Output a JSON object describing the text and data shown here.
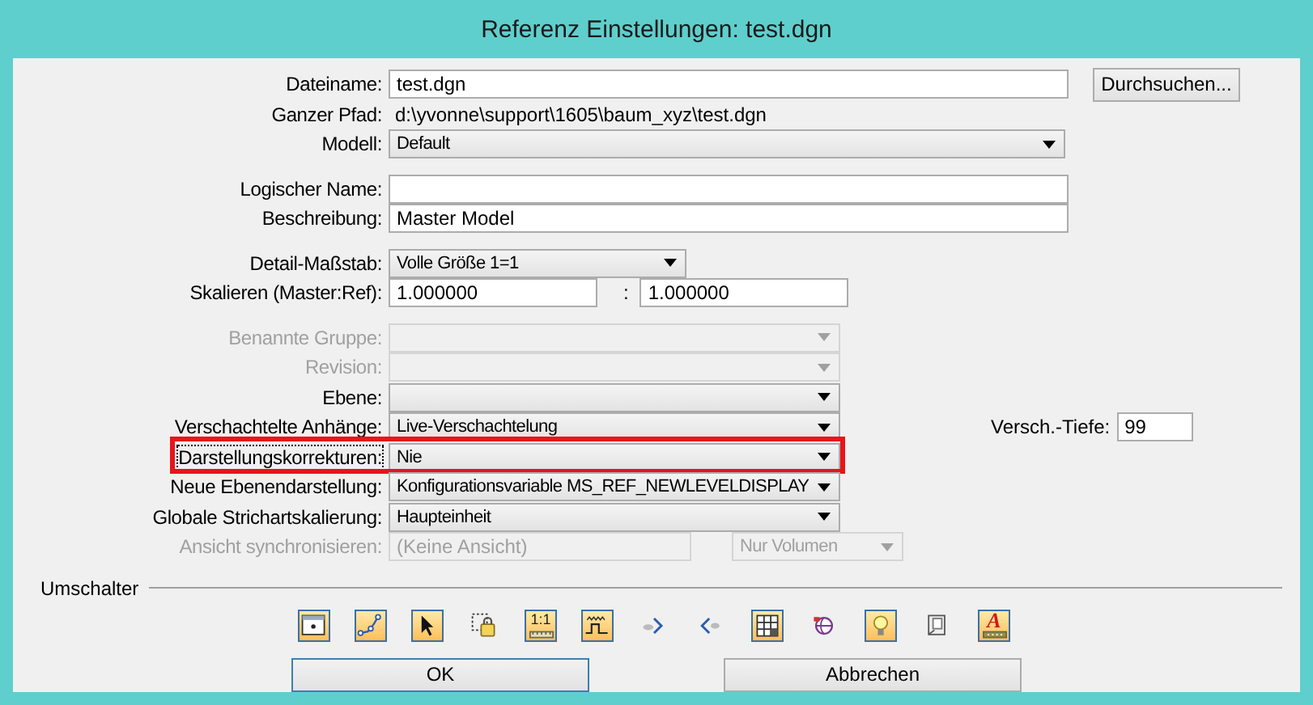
{
  "window": {
    "title": "Referenz Einstellungen: test.dgn"
  },
  "sections": [
    {
      "rows": [
        {
          "kind": "field",
          "label": "Dateiname:",
          "value": "test.dgn",
          "button": "Durchsuchen..."
        },
        {
          "kind": "static",
          "label": "Ganzer Pfad:",
          "value": "d:\\yvonne\\support\\1605\\baum_xyz\\test.dgn"
        },
        {
          "kind": "combo",
          "label": "Modell:",
          "value": "Default",
          "disabled": false
        }
      ]
    },
    {
      "rows": [
        {
          "kind": "field",
          "label": "Logischer Name:",
          "value": ""
        },
        {
          "kind": "field",
          "label": "Beschreibung:",
          "value": "Master Model"
        }
      ]
    },
    {
      "rows": [
        {
          "kind": "combo",
          "label": "Detail-Maßstab:",
          "value": "Volle Größe 1=1",
          "disabled": false
        },
        {
          "kind": "ratio",
          "label": "Skalieren (Master:Ref):",
          "values": [
            "1.000000",
            "1.000000"
          ],
          "separator": ":"
        }
      ]
    },
    {
      "rows": [
        {
          "kind": "combo",
          "label": "Benannte Gruppe:",
          "value": "",
          "disabled": true
        },
        {
          "kind": "combo",
          "label": "Revision:",
          "value": "",
          "disabled": true
        },
        {
          "kind": "combo",
          "label": "Ebene:",
          "value": "",
          "disabled": false
        },
        {
          "kind": "combo",
          "label": "Verschachtelte Anhänge:",
          "value": "Live-Verschachtelung",
          "disabled": false,
          "side": {
            "label": "Versch.-Tiefe:",
            "value": "99"
          }
        },
        {
          "kind": "combo",
          "label": "Darstellungskorrekturen:",
          "value": "Nie",
          "disabled": false,
          "focused": true,
          "highlighted": true
        },
        {
          "kind": "combo",
          "label": "Neue Ebenendarstellung:",
          "value": "Konfigurationsvariable MS_REF_NEWLEVELDISPLAY",
          "disabled": false
        },
        {
          "kind": "combo",
          "label": "Globale Strichartskalierung:",
          "value": "Haupteinheit",
          "disabled": false
        },
        {
          "kind": "sync",
          "label": "Ansicht synchronisieren:",
          "value": "(Keine Ansicht)",
          "option": "Nur Volumen",
          "disabled": true
        }
      ]
    }
  ],
  "toggles": {
    "label": "Umschalter",
    "items": [
      {
        "kind": "view",
        "on": true
      },
      {
        "kind": "curve",
        "on": true
      },
      {
        "kind": "pointer",
        "on": true
      },
      {
        "kind": "lock",
        "on": false
      },
      {
        "kind": "scale",
        "on": true,
        "label": "1:1"
      },
      {
        "kind": "wave",
        "on": true
      },
      {
        "kind": "clip-in",
        "on": false
      },
      {
        "kind": "clip-out",
        "on": false
      },
      {
        "kind": "grid",
        "on": true
      },
      {
        "kind": "globe",
        "on": false
      },
      {
        "kind": "bulb",
        "on": true
      },
      {
        "kind": "book",
        "on": false
      },
      {
        "kind": "text-style",
        "on": true,
        "label": "A"
      }
    ]
  },
  "buttons": [
    {
      "label": "OK",
      "default": true
    },
    {
      "label": "Abbrechen",
      "default": false
    }
  ]
}
